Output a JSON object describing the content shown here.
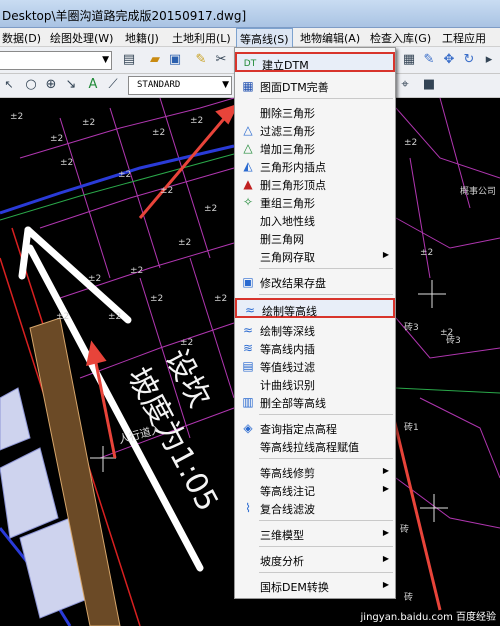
{
  "window": {
    "title": "Desktop\\羊圈沟道路完成版20150917.dwg]"
  },
  "menubar": {
    "items": [
      {
        "label": "数据(D)"
      },
      {
        "label": "绘图处理(W)"
      },
      {
        "label": "地籍(J)"
      },
      {
        "label": "土地利用(L)"
      },
      {
        "label": "等高线(S)"
      },
      {
        "label": "地物编辑(A)"
      },
      {
        "label": "检查入库(G)"
      },
      {
        "label": "工程应用"
      }
    ]
  },
  "toolbar": {
    "style_combo": "STANDARD"
  },
  "dropdown": {
    "items": [
      {
        "label": "建立DTM",
        "icon": "dtm-icon"
      },
      {
        "label": "图面DTM完善",
        "icon": "dtm-refine-icon"
      },
      {
        "label": "删除三角形",
        "icon": ""
      },
      {
        "label": "过滤三角形",
        "icon": "filter-triangle-icon"
      },
      {
        "label": "增加三角形",
        "icon": "add-triangle-icon"
      },
      {
        "label": "三角形内插点",
        "icon": "interpolate-icon"
      },
      {
        "label": "删三角形顶点",
        "icon": "delete-vertex-icon"
      },
      {
        "label": "重组三角形",
        "icon": "reorganize-icon"
      },
      {
        "label": "加入地性线",
        "icon": ""
      },
      {
        "label": "删三角网",
        "icon": ""
      },
      {
        "label": "三角网存取",
        "icon": "",
        "submenu": true
      },
      {
        "label": "修改结果存盘",
        "icon": "save-result-icon"
      },
      {
        "label": "绘制等高线",
        "icon": "draw-contour-icon"
      },
      {
        "label": "绘制等深线",
        "icon": "draw-isobath-icon"
      },
      {
        "label": "等高线内插",
        "icon": "contour-interp-icon"
      },
      {
        "label": "等值线过滤",
        "icon": "contour-filter-icon"
      },
      {
        "label": "计曲线识别",
        "icon": ""
      },
      {
        "label": "删全部等高线",
        "icon": "delete-contours-icon"
      },
      {
        "label": "查询指定点高程",
        "icon": "query-elevation-icon"
      },
      {
        "label": "等高线拉线高程赋值",
        "icon": ""
      },
      {
        "label": "等高线修剪",
        "icon": "",
        "submenu": true
      },
      {
        "label": "等高线注记",
        "icon": "",
        "submenu": true
      },
      {
        "label": "复合线滤波",
        "icon": "polyline-filter-icon"
      },
      {
        "label": "三维模型",
        "icon": "",
        "submenu": true
      },
      {
        "label": "坡度分析",
        "icon": "",
        "submenu": true
      },
      {
        "label": "国标DEM转换",
        "icon": "",
        "submenu": true
      }
    ]
  },
  "cad": {
    "labels": [
      "±2",
      "±2",
      "±2",
      "±2",
      "±2",
      "±2",
      "±2",
      "±2",
      "±2",
      "±2",
      "±2",
      "±2",
      "±2",
      "±2",
      "±2",
      "±2",
      "±2",
      "±2",
      "±2",
      "±2"
    ],
    "right_labels": [
      "砖3",
      "砖3",
      "砖1",
      "砖",
      "砖",
      "概事公司"
    ],
    "overlay_1": "坡度为1:05",
    "overlay_2": "人行道入",
    "overlay_3": "设坎"
  },
  "watermark": "jingyan.baidu.com 百度经验"
}
